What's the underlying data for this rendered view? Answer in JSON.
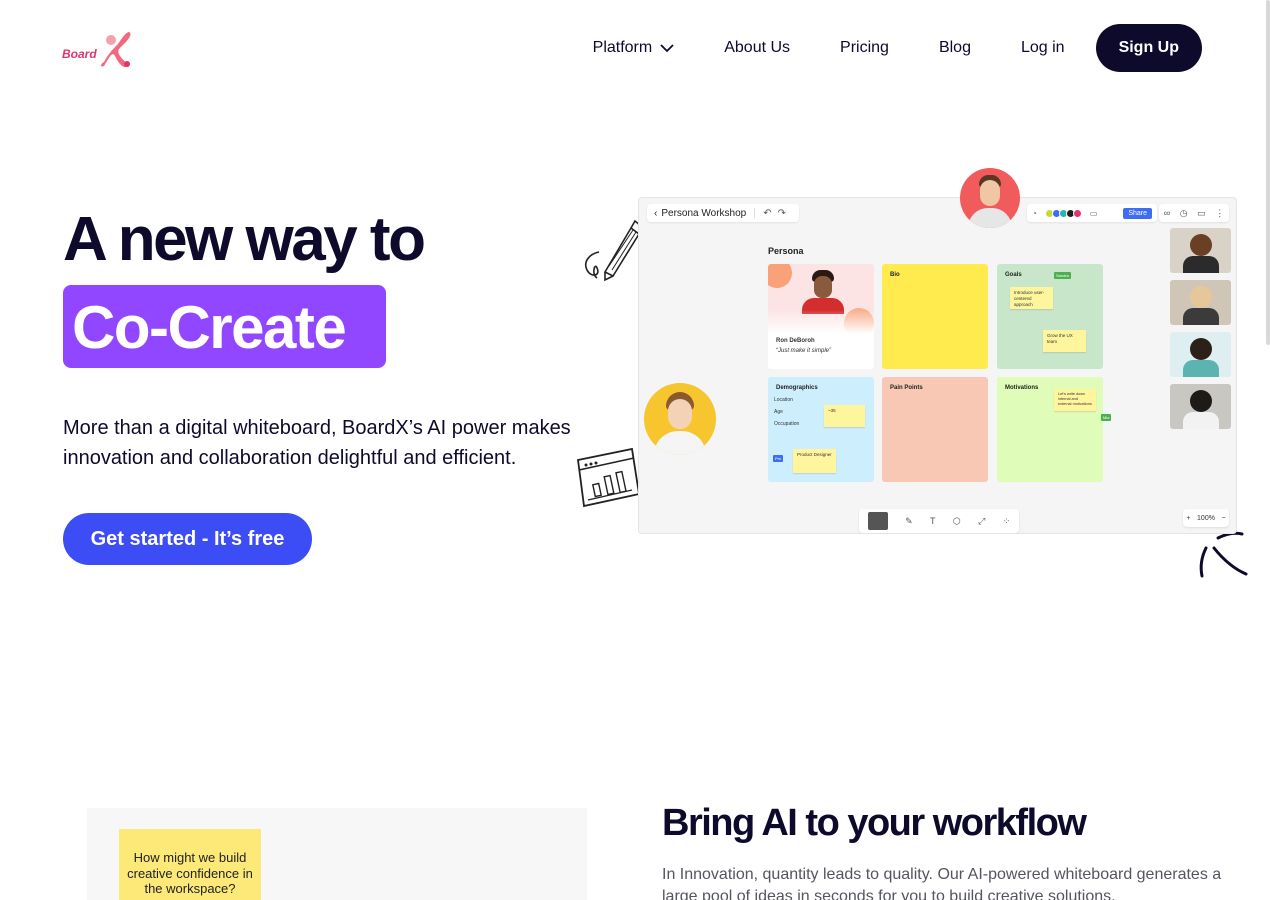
{
  "header": {
    "logo_text": "Board",
    "nav": [
      "Platform",
      "About Us",
      "Pricing",
      "Blog",
      "Log in"
    ],
    "signup_label": "Sign Up"
  },
  "hero": {
    "line1": "A new way to",
    "highlight": "Co-Create",
    "description": "More than a digital whiteboard, BoardX’s AI power makes innovation and collaboration delightful and efficient.",
    "cta_label": "Get started - It’s free"
  },
  "board": {
    "workspace_title": "Persona Workshop",
    "share_label": "Share",
    "section_title": "Persona",
    "persona_name": "Ron DeBoroh",
    "persona_quote": "“Just make it simple”",
    "cards": {
      "bio": "Bio",
      "goals": "Goals",
      "demographics": "Demographics",
      "pain_points": "Pain Points",
      "motivations": "Motivations"
    },
    "goal_sticky_1": "Introduce user-centered approach",
    "goal_sticky_2": "Grow the UX team",
    "goal_badge": "Sandra",
    "demo_fields": [
      "Location",
      "Age",
      "Occupation"
    ],
    "demo_age_sticky": "~35",
    "demo_occupation_sticky": "Product Designer",
    "demo_badge": "Pm",
    "motivation_sticky": "Let's write down internal and external motivations",
    "motivation_badge": "Mia",
    "zoom_level": "100%",
    "colors": {
      "persona": "#fde4e4",
      "bio": "#ffeb4d",
      "goals": "#c8e6c9",
      "demographics": "#cdeefd",
      "pain_points": "#f8c8b4",
      "motivations": "#dffcb8"
    }
  },
  "section2": {
    "sticky_text": "How might we build creative confidence in the workspace?",
    "title": "Bring AI to your workflow",
    "description": "In Innovation, quantity leads to quality. Our AI-powered whiteboard generates a large pool of ideas in seconds for you to build creative solutions."
  }
}
